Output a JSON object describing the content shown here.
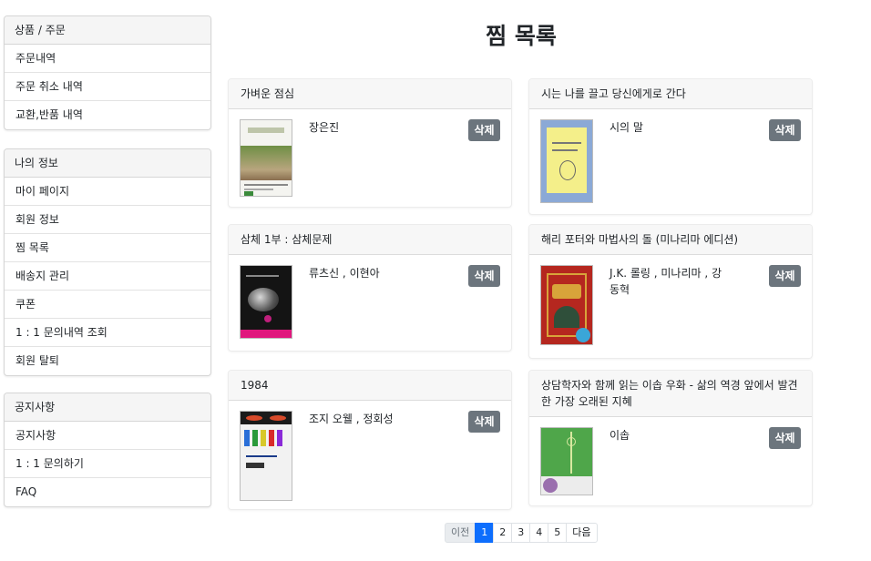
{
  "sidebar": {
    "groups": [
      {
        "title": "상품 / 주문",
        "items": [
          "주문내역",
          "주문 취소 내역",
          "교환,반품 내역"
        ]
      },
      {
        "title": "나의 정보",
        "items": [
          "마이 페이지",
          "회원 정보",
          "찜 목록",
          "배송지 관리",
          "쿠폰",
          "1 : 1 문의내역 조회",
          "회원 탈퇴"
        ]
      },
      {
        "title": "공지사항",
        "items": [
          "공지사항",
          "1 : 1 문의하기",
          "FAQ"
        ]
      }
    ]
  },
  "page": {
    "title": "찜 목록"
  },
  "wishlist": {
    "delete_label": "삭제",
    "items": [
      {
        "title": "가벼운 점심",
        "author": "장은진"
      },
      {
        "title": "시는 나를 끌고 당신에게로 간다",
        "author": "시의 말"
      },
      {
        "title": "삼체 1부 : 삼체문제",
        "author": "류츠신 , 이현아"
      },
      {
        "title": "해리 포터와 마법사의 돌 (미나리마 에디션)",
        "author": "J.K. 롤링 , 미나리마 , 강동혁"
      },
      {
        "title": "1984",
        "author": "조지 오웰 , 정회성"
      },
      {
        "title": "상담학자와 함께 읽는 이솝 우화 - 삶의 역경 앞에서 발견한 가장 오래된 지혜",
        "author": "이솝"
      }
    ]
  },
  "pagination": {
    "prev": "이전",
    "pages": [
      "1",
      "2",
      "3",
      "4",
      "5"
    ],
    "current": "1",
    "next": "다음"
  }
}
